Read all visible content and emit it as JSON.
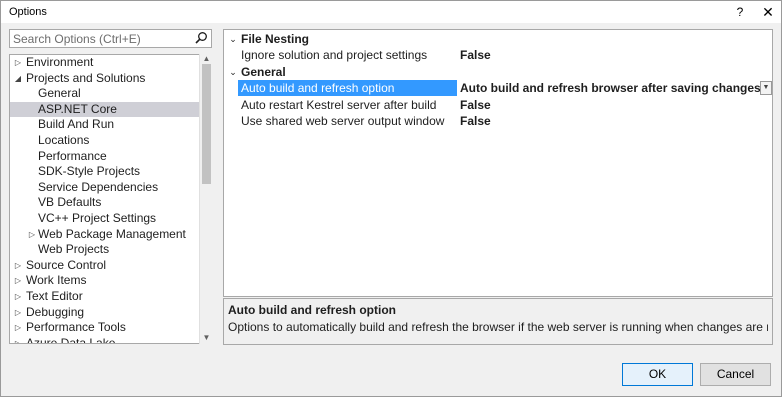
{
  "window": {
    "title": "Options",
    "help_glyph": "?",
    "close_glyph": "✕"
  },
  "search": {
    "placeholder": "Search Options (Ctrl+E)",
    "icon": "search-icon"
  },
  "tree": {
    "items": [
      {
        "label": "Environment",
        "arrow": "collapsed"
      },
      {
        "label": "Projects and Solutions",
        "arrow": "expanded"
      },
      {
        "label": "General"
      },
      {
        "label": "ASP.NET Core",
        "selected": true
      },
      {
        "label": "Build And Run"
      },
      {
        "label": "Locations"
      },
      {
        "label": "Performance"
      },
      {
        "label": "SDK-Style Projects"
      },
      {
        "label": "Service Dependencies"
      },
      {
        "label": "VB Defaults"
      },
      {
        "label": "VC++ Project Settings"
      },
      {
        "label": "Web Package Management",
        "arrow": "collapsed"
      },
      {
        "label": "Web Projects"
      },
      {
        "label": "Source Control",
        "arrow": "collapsed"
      },
      {
        "label": "Work Items",
        "arrow": "collapsed"
      },
      {
        "label": "Text Editor",
        "arrow": "collapsed"
      },
      {
        "label": "Debugging",
        "arrow": "collapsed"
      },
      {
        "label": "Performance Tools",
        "arrow": "collapsed"
      },
      {
        "label": "Azure Data Lake",
        "arrow": "collapsed"
      }
    ]
  },
  "grid": {
    "categories": [
      {
        "label": "File Nesting",
        "properties": [
          {
            "name": "Ignore solution and project settings",
            "value": "False"
          }
        ]
      },
      {
        "label": "General",
        "properties": [
          {
            "name": "Auto build and refresh option",
            "value": "Auto build and refresh browser after saving changes",
            "selected": true
          },
          {
            "name": "Auto restart Kestrel server after build",
            "value": "False"
          },
          {
            "name": "Use shared web server output window",
            "value": "False"
          }
        ]
      }
    ]
  },
  "description": {
    "title": "Auto build and refresh option",
    "text": "Options to automatically build and refresh the browser if the web server is running when changes are made to the pro..."
  },
  "buttons": {
    "ok": "OK",
    "cancel": "Cancel"
  },
  "colors": {
    "selection": "#3399ff",
    "tree_selection": "#cfcfd6"
  }
}
